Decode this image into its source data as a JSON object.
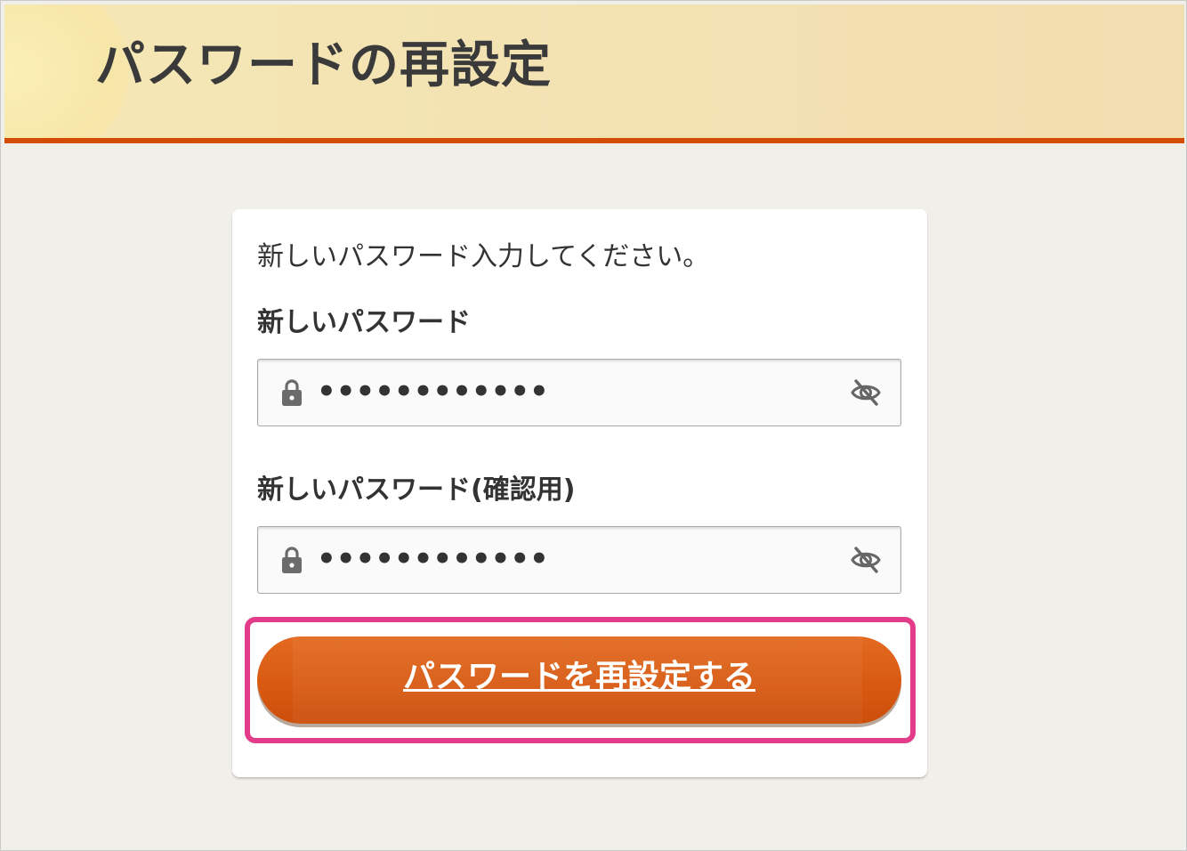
{
  "header": {
    "title": "パスワードの再設定"
  },
  "form": {
    "instruction": "新しいパスワード入力してください。",
    "new_password": {
      "label": "新しいパスワード",
      "value": "••••••••••••"
    },
    "confirm_password": {
      "label": "新しいパスワード(確認用)",
      "value": "••••••••••••"
    },
    "submit_label": "パスワードを再設定する"
  },
  "icons": {
    "lock": "lock-icon",
    "visibility": "eye-off-icon"
  },
  "colors": {
    "accent": "#d44d07",
    "button": "#dd6016",
    "highlight": "#e33c8a",
    "header_bg": "#f3e3b3"
  }
}
